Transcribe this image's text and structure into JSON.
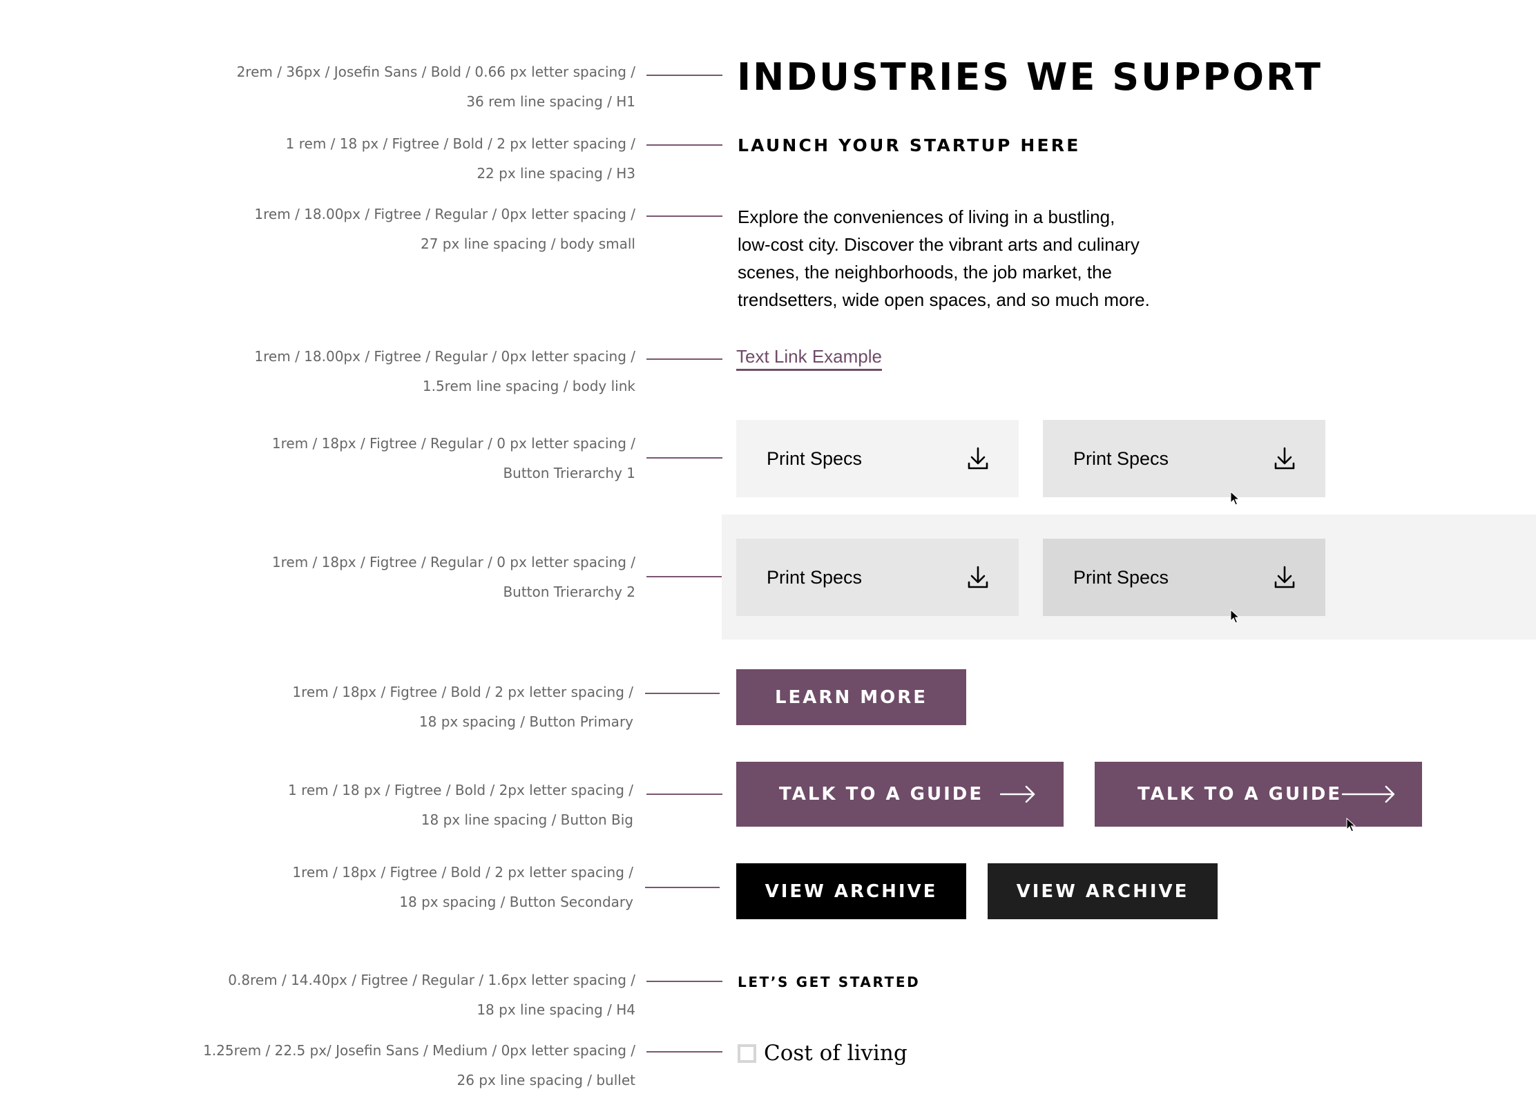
{
  "annotations": [
    {
      "line1": "2rem / 36px / Josefin Sans / Bold / 0.66 px letter spacing /",
      "line2": "36 rem line spacing / H1"
    },
    {
      "line1": "1 rem / 18 px / Figtree / Bold / 2 px letter spacing /",
      "line2": "22 px line spacing / H3"
    },
    {
      "line1": "1rem / 18.00px / Figtree / Regular / 0px letter spacing /",
      "line2": "27 px line spacing / body small"
    },
    {
      "line1": "1rem / 18.00px / Figtree / Regular / 0px letter spacing /",
      "line2": "1.5rem line spacing / body link"
    },
    {
      "line1": "1rem / 18px / Figtree / Regular / 0 px letter spacing /",
      "line2": "Button Trierarchy 1"
    },
    {
      "line1": "1rem / 18px / Figtree / Regular / 0 px letter spacing /",
      "line2": "Button Trierarchy 2"
    },
    {
      "line1": "1rem / 18px / Figtree / Bold / 2 px letter spacing /",
      "line2": "18 px spacing / Button Primary"
    },
    {
      "line1": "1 rem / 18 px / Figtree / Bold / 2px letter spacing /",
      "line2": "18 px line spacing / Button Big"
    },
    {
      "line1": "1rem / 18px / Figtree / Bold / 2 px letter spacing /",
      "line2": "18 px spacing / Button Secondary"
    },
    {
      "line1": "0.8rem / 14.40px / Figtree / Regular / 1.6px letter spacing /",
      "line2": "18 px line spacing / H4"
    },
    {
      "line1": "1.25rem / 22.5 px/  Josefin Sans / Medium / 0px letter spacing /",
      "line2": "26 px line spacing / bullet"
    }
  ],
  "samples": {
    "h1": "INDUSTRIES WE SUPPORT",
    "h3": "LAUNCH YOUR STARTUP HERE",
    "body_lines": [
      "Explore the conveniences of living in a bustling,",
      "low-cost city. Discover the vibrant arts and culinary",
      "scenes, the neighborhoods, the job market, the",
      "trendsetters, wide open spaces, and so much more."
    ],
    "text_link": "Text Link Example",
    "print_specs": "Print Specs",
    "learn_more": "LEARN MORE",
    "talk_to_guide": "TALK TO A GUIDE",
    "view_archive": "VIEW ARCHIVE",
    "h4": "LET’S GET STARTED",
    "bullet": "Cost of living"
  },
  "colors": {
    "accent_purple": "#6f4c68",
    "primary_button": "#6f4c68",
    "secondary_button": "#000000",
    "secondary_button_hover": "#1f1f1f",
    "tier1_button": "#f3f3f3",
    "tier1_button_hover": "#e6e6e6",
    "tier2_background": "#f3f3f3",
    "tier2_button": "#e6e6e6",
    "tier2_button_hover": "#d9d9d9",
    "annotation_text": "#666666"
  },
  "icons": {
    "download": "download-icon",
    "arrow": "arrow-right-icon",
    "cursor": "mouse-cursor-icon",
    "bullet": "checkbox-icon"
  }
}
